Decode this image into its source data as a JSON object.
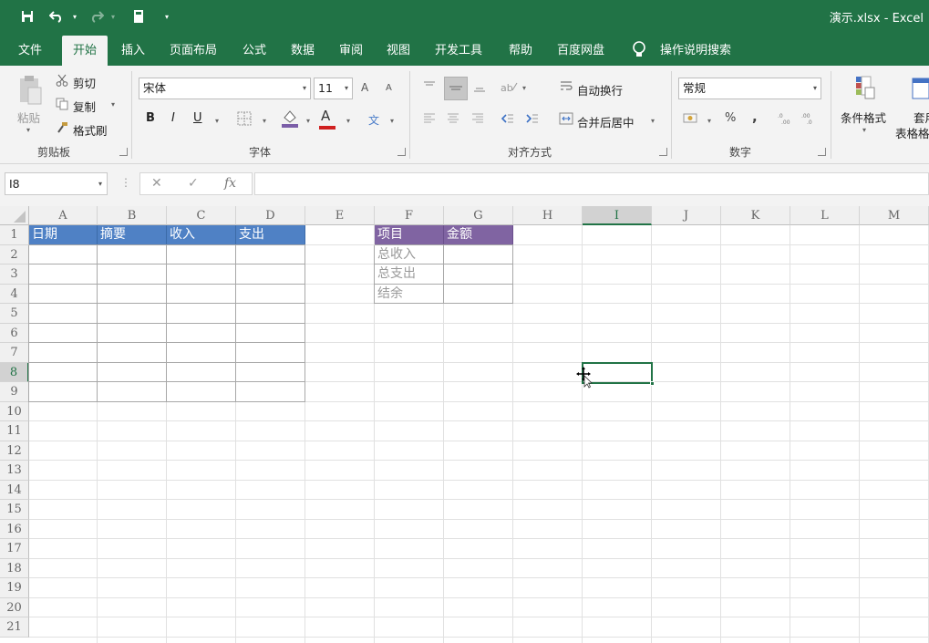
{
  "window": {
    "title": "演示.xlsx  -  Excel"
  },
  "quick_access": {
    "save_icon": "save-icon",
    "undo_icon": "undo-icon",
    "redo_icon": "redo-icon",
    "calc_icon": "calculator-icon",
    "more": "▾"
  },
  "menu": {
    "tabs": [
      "文件",
      "开始",
      "插入",
      "页面布局",
      "公式",
      "数据",
      "审阅",
      "视图",
      "开发工具",
      "帮助",
      "百度网盘"
    ],
    "active_tab": "开始",
    "tell_me": "操作说明搜索"
  },
  "ribbon": {
    "clipboard": {
      "group_label": "剪贴板",
      "paste": "粘贴",
      "cut": "剪切",
      "copy": "复制",
      "format_painter": "格式刷"
    },
    "font": {
      "group_label": "字体",
      "font_name": "宋体",
      "font_size": "11",
      "bold": "B",
      "italic": "I",
      "underline": "U",
      "grow": "A",
      "shrink": "A",
      "font_color": "A",
      "wen": "文"
    },
    "alignment": {
      "group_label": "对齐方式",
      "wrap_text": "自动换行",
      "merge_center": "合并后居中"
    },
    "number": {
      "group_label": "数字",
      "format": "常规",
      "percent": "%",
      "comma": ","
    },
    "styles": {
      "conditional_format": "条件格式",
      "table_format_1": "套用",
      "table_format_2": "表格格"
    }
  },
  "formula_bar": {
    "name_box": "I8",
    "cancel": "✕",
    "enter": "✓",
    "fx": "fx",
    "formula": ""
  },
  "sheet": {
    "columns": [
      "A",
      "B",
      "C",
      "D",
      "E",
      "F",
      "G",
      "H",
      "I",
      "J",
      "K",
      "L",
      "M"
    ],
    "rows": [
      "1",
      "2",
      "3",
      "4",
      "5",
      "6",
      "7",
      "8",
      "9",
      "10",
      "11",
      "12",
      "13",
      "14",
      "15",
      "16",
      "17",
      "18",
      "19",
      "20",
      "21"
    ],
    "selected_cell": "I8",
    "table1_headers": [
      "日期",
      "摘要",
      "收入",
      "支出"
    ],
    "table2_headers": [
      "项目",
      "金额"
    ],
    "table2_labels": [
      "总收入",
      "总支出",
      "结余"
    ],
    "colors": {
      "blue_header": "#4f81c5",
      "purple_header": "#8064a2",
      "excel_green": "#217346"
    }
  }
}
